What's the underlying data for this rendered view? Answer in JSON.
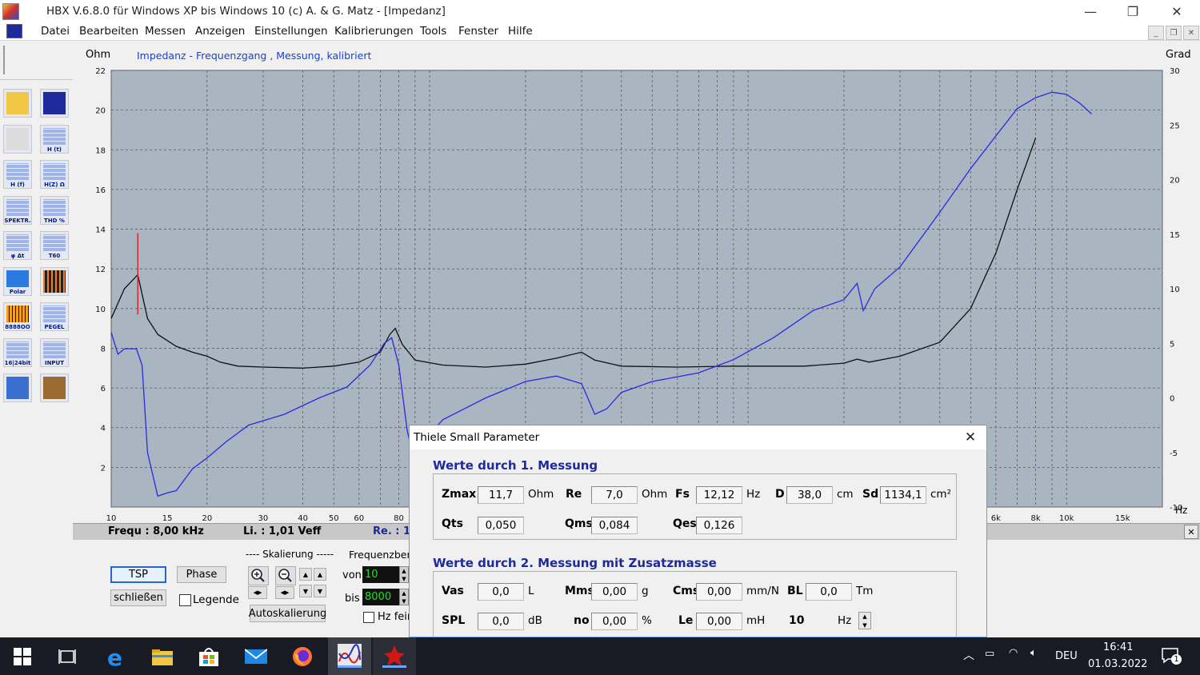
{
  "window": {
    "title": "HBX V.6.8.0    für Windows XP bis Windows 10     (c)  A. & G. Matz - [Impedanz]",
    "minimize_glyph": "—",
    "restore_glyph": "❐",
    "close_glyph": "✕"
  },
  "menu": [
    "Datei",
    "Bearbeiten",
    "Messen",
    "Anzeigen",
    "Einstellungen",
    "Kalibrierungen",
    "Tools",
    "Fenster",
    "Hilfe"
  ],
  "toolbar": {
    "buttons": [
      {
        "name": "open-folder",
        "label": ""
      },
      {
        "name": "save",
        "label": ""
      },
      {
        "name": "print",
        "label": ""
      },
      {
        "name": "h-t",
        "label": "H (t)"
      },
      {
        "name": "h-f",
        "label": "H (f)"
      },
      {
        "name": "h-z-ohm",
        "label": "H(Z) Ω"
      },
      {
        "name": "spektr",
        "label": "SPEKTR."
      },
      {
        "name": "thd",
        "label": "THD %"
      },
      {
        "name": "phi-dt",
        "label": "φ   Δt"
      },
      {
        "name": "t60",
        "label": "T60"
      },
      {
        "name": "polar",
        "label": "Polar"
      },
      {
        "name": "scope",
        "label": ""
      },
      {
        "name": "bargraph",
        "label": "8888OO"
      },
      {
        "name": "pegel",
        "label": "PEGEL"
      },
      {
        "name": "bit",
        "label": "16|24bit"
      },
      {
        "name": "input",
        "label": "INPUT"
      },
      {
        "name": "microphone",
        "label": ""
      },
      {
        "name": "exit",
        "label": ""
      }
    ]
  },
  "chart_data": {
    "type": "line",
    "title": "Impedanz - Frequenzgang , Messung, kalibriert",
    "ylabel": "Ohm",
    "y2label": "Grad",
    "xlabel": "Hz",
    "x_scale": "log",
    "xlim": [
      10,
      20000
    ],
    "ylim": [
      0,
      22
    ],
    "y2lim": [
      -10,
      30
    ],
    "yticks": [
      2,
      4,
      6,
      8,
      10,
      12,
      14,
      16,
      18,
      20,
      22
    ],
    "y2ticks": [
      -10,
      -5,
      0,
      5,
      10,
      15,
      20,
      25,
      30
    ],
    "xticks": [
      {
        "v": 10,
        "l": "10"
      },
      {
        "v": 15,
        "l": "15"
      },
      {
        "v": 20,
        "l": "20"
      },
      {
        "v": 30,
        "l": "30"
      },
      {
        "v": 40,
        "l": "40"
      },
      {
        "v": 50,
        "l": "50"
      },
      {
        "v": 60,
        "l": "60"
      },
      {
        "v": 80,
        "l": "80"
      },
      {
        "v": 5000,
        "l": "5k"
      },
      {
        "v": 6000,
        "l": "6k"
      },
      {
        "v": 8000,
        "l": "8k"
      },
      {
        "v": 10000,
        "l": "10k"
      },
      {
        "v": 15000,
        "l": "15k"
      }
    ],
    "grid": true,
    "cursor": {
      "x": 12.12,
      "y_from": 9.7,
      "y_to": 13.8,
      "color": "#e02020"
    },
    "series": [
      {
        "color": "#101010",
        "axis": "left",
        "points": [
          [
            10,
            9.5
          ],
          [
            11,
            11
          ],
          [
            12.12,
            11.7
          ],
          [
            13,
            9.5
          ],
          [
            14,
            8.7
          ],
          [
            16,
            8.1
          ],
          [
            18,
            7.8
          ],
          [
            20,
            7.6
          ],
          [
            22,
            7.3
          ],
          [
            25,
            7.1
          ],
          [
            30,
            7.05
          ],
          [
            40,
            7.0
          ],
          [
            50,
            7.1
          ],
          [
            60,
            7.3
          ],
          [
            70,
            7.8
          ],
          [
            75,
            8.7
          ],
          [
            78,
            9.0
          ],
          [
            82,
            8.2
          ],
          [
            90,
            7.4
          ],
          [
            110,
            7.15
          ],
          [
            150,
            7.05
          ],
          [
            200,
            7.2
          ],
          [
            250,
            7.5
          ],
          [
            300,
            7.8
          ],
          [
            330,
            7.4
          ],
          [
            400,
            7.1
          ],
          [
            600,
            7.05
          ],
          [
            900,
            7.1
          ],
          [
            1500,
            7.1
          ],
          [
            2000,
            7.25
          ],
          [
            2200,
            7.45
          ],
          [
            2400,
            7.3
          ],
          [
            3000,
            7.6
          ],
          [
            4000,
            8.3
          ],
          [
            5000,
            10.0
          ],
          [
            6000,
            12.8
          ],
          [
            7000,
            16.0
          ],
          [
            8000,
            18.6
          ]
        ]
      },
      {
        "color": "#2a2ae0",
        "axis": "right",
        "points": [
          [
            10,
            6
          ],
          [
            10.5,
            4
          ],
          [
            11,
            4.5
          ],
          [
            12,
            4.5
          ],
          [
            12.5,
            3
          ],
          [
            13,
            -5
          ],
          [
            14,
            -9
          ],
          [
            15,
            -8.7
          ],
          [
            16,
            -8.5
          ],
          [
            18,
            -6.5
          ],
          [
            20,
            -5.5
          ],
          [
            23,
            -4
          ],
          [
            27,
            -2.5
          ],
          [
            35,
            -1.5
          ],
          [
            45,
            0
          ],
          [
            55,
            1
          ],
          [
            65,
            3
          ],
          [
            72,
            5
          ],
          [
            76,
            5.5
          ],
          [
            80,
            3
          ],
          [
            85,
            -3
          ],
          [
            90,
            -6
          ],
          [
            95,
            -4
          ],
          [
            110,
            -2
          ],
          [
            150,
            0
          ],
          [
            200,
            1.5
          ],
          [
            250,
            2
          ],
          [
            300,
            1.3
          ],
          [
            330,
            -1.5
          ],
          [
            360,
            -1
          ],
          [
            400,
            0.5
          ],
          [
            500,
            1.5
          ],
          [
            700,
            2.3
          ],
          [
            900,
            3.5
          ],
          [
            1200,
            5.5
          ],
          [
            1600,
            8
          ],
          [
            2000,
            9
          ],
          [
            2200,
            10.5
          ],
          [
            2300,
            8
          ],
          [
            2500,
            10
          ],
          [
            3000,
            12
          ],
          [
            4000,
            17
          ],
          [
            5000,
            21
          ],
          [
            6000,
            24
          ],
          [
            7000,
            26.5
          ],
          [
            8000,
            27.5
          ],
          [
            9000,
            28
          ],
          [
            10000,
            27.8
          ],
          [
            11000,
            27
          ],
          [
            12000,
            26
          ]
        ]
      }
    ]
  },
  "status": {
    "frequ": "Frequ : 8,00 kHz",
    "li": "Li. : 1,01 Veff",
    "re": "Re. : 1"
  },
  "panel": {
    "tsp": "TSP",
    "phase": "Phase",
    "schliessen": "schließen",
    "legende": "Legende",
    "skalierung": "---- Skalierung -----",
    "autoskalierung": "Autoskalierung",
    "frequenzbereich": "Frequenzbere",
    "von_label": "von",
    "von_value": "10",
    "bis_label": "bis",
    "bis_value": "8000",
    "hz_fein": "Hz fein"
  },
  "dialog": {
    "title": "Thiele Small Parameter",
    "group1_title": "Werte durch 1. Messung",
    "group2_title": "Werte durch 2. Messung mit Zusatzmasse",
    "g1": {
      "zmax": {
        "label": "Zmax",
        "value": "11,7",
        "unit": "Ohm"
      },
      "re": {
        "label": "Re",
        "value": "7,0",
        "unit": "Ohm"
      },
      "fs": {
        "label": "Fs",
        "value": "12,12",
        "unit": "Hz"
      },
      "d": {
        "label": "D",
        "value": "38,0",
        "unit": "cm"
      },
      "sd": {
        "label": "Sd",
        "value": "1134,1",
        "unit": "cm²"
      },
      "qts": {
        "label": "Qts",
        "value": "0,050"
      },
      "qms": {
        "label": "Qms",
        "value": "0,084"
      },
      "qes": {
        "label": "Qes",
        "value": "0,126"
      }
    },
    "g2": {
      "vas": {
        "label": "Vas",
        "value": "0,0",
        "unit": "L"
      },
      "mms": {
        "label": "Mms",
        "value": "0,00",
        "unit": "g"
      },
      "cms": {
        "label": "Cms",
        "value": "0,00",
        "unit": "mm/N"
      },
      "bl": {
        "label": "BL",
        "value": "0,0",
        "unit": "Tm"
      },
      "spl": {
        "label": "SPL",
        "value": "0,0",
        "unit": "dB"
      },
      "no": {
        "label": "no",
        "value": "0,00",
        "unit": "%"
      },
      "le": {
        "label": "Le",
        "value": "0,00",
        "unit": "mH"
      },
      "hz": {
        "value": "10",
        "unit": "Hz"
      }
    }
  },
  "taskbar": {
    "lang": "DEU",
    "time": "16:41",
    "date": "01.03.2022",
    "notifications": "1"
  },
  "colors": {
    "plot_bg": "#a9b6c2",
    "grid": "#5a5a5a",
    "accent_blue": "#1e2a9c",
    "title_blue": "#1a3fd8"
  }
}
